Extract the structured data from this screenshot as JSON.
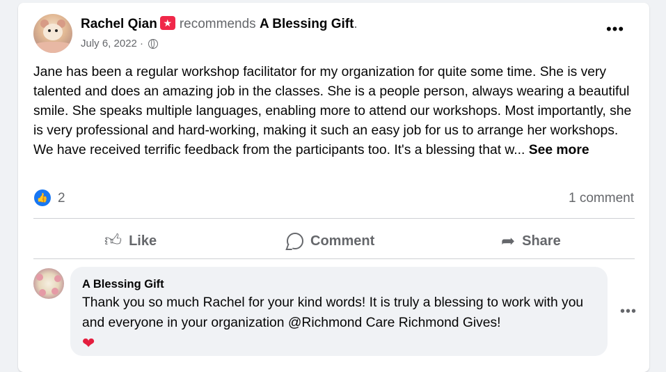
{
  "post": {
    "author": "Rachel Qian",
    "badge_icon": "star-badge-icon",
    "recommends_text": "recommends",
    "page_name": "A Blessing Gift",
    "page_suffix": ".",
    "date": "July 6, 2022",
    "date_sep": " · ",
    "audience_icon": "globe-icon",
    "more_label": "•••",
    "text": "Jane has been a regular workshop facilitator for my organization for quite some time. She is very talented and does an amazing job in the classes. She is a people person, always wearing a beautiful smile. She speaks multiple languages, enabling more to attend our workshops. Most importantly, she is very professional and hard-working, making it such an easy job for us to arrange her workshops. We have received terrific feedback from the participants too. It's a blessing that w...",
    "see_more": "See more"
  },
  "stats": {
    "like_count": "2",
    "comment_count": "1 comment",
    "like_color": "#1877f2"
  },
  "actions": {
    "like": "Like",
    "comment": "Comment",
    "share": "Share"
  },
  "comment": {
    "author": "A Blessing Gift",
    "text": "Thank you so much Rachel for your kind words! It is truly a blessing to work with you and everyone in your organization @Richmond Care Richmond Gives!",
    "heart": "❤",
    "more_label": "•••"
  }
}
